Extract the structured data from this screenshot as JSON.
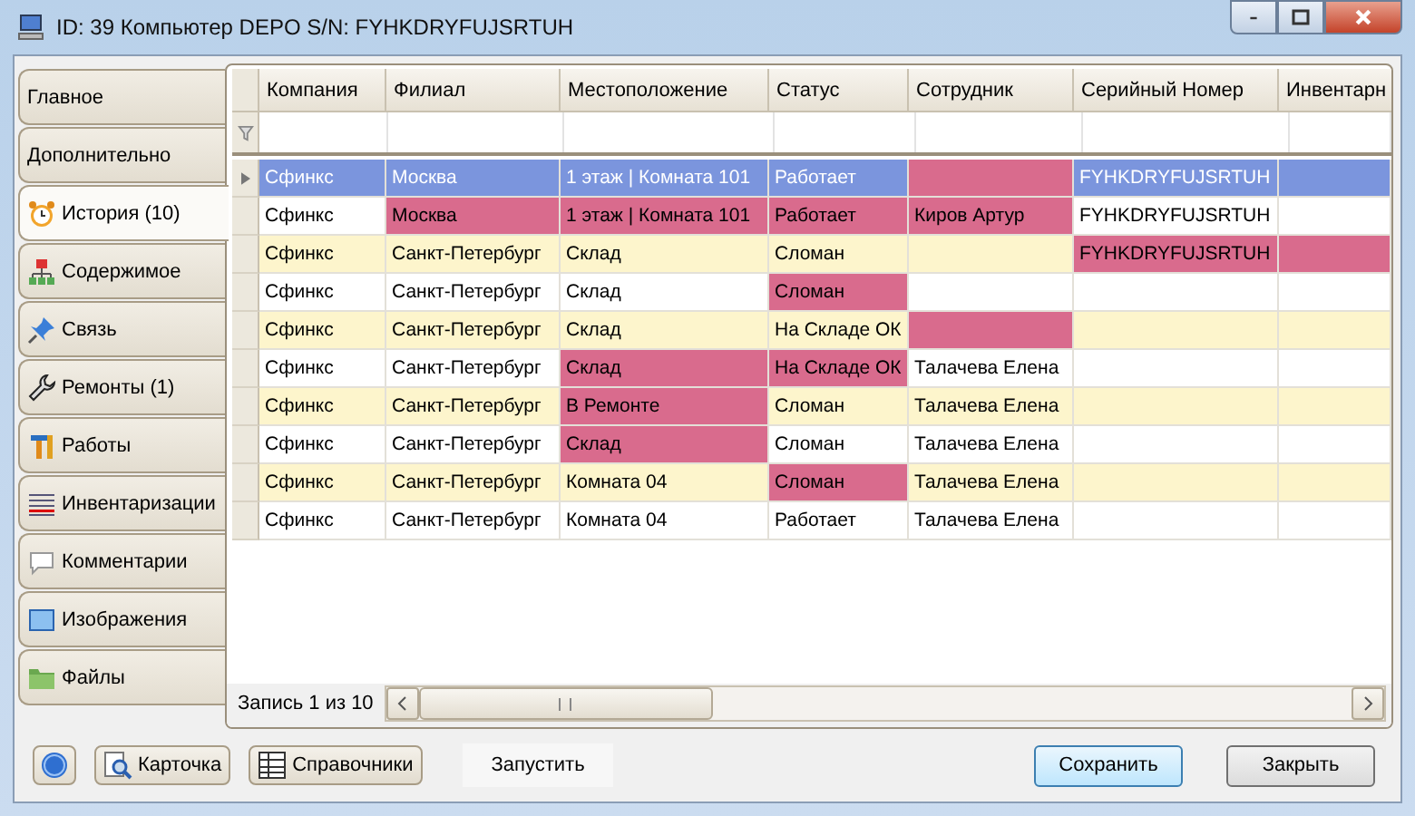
{
  "window": {
    "title": "ID: 39  Компьютер DEPO S/N: FYHKDRYFUJSRTUH"
  },
  "tabs": [
    {
      "label": "Главное",
      "selected": false
    },
    {
      "label": "Дополнительно",
      "selected": false
    },
    {
      "label": "История (10)",
      "selected": true
    },
    {
      "label": "Содержимое",
      "selected": false
    },
    {
      "label": "Связь",
      "selected": false
    },
    {
      "label": "Ремонты (1)",
      "selected": false
    },
    {
      "label": "Работы",
      "selected": false
    },
    {
      "label": "Инвентаризации",
      "selected": false
    },
    {
      "label": "Комментарии",
      "selected": false
    },
    {
      "label": "Изображения",
      "selected": false
    },
    {
      "label": "Файлы",
      "selected": false
    }
  ],
  "table": {
    "columns": [
      "Компания",
      "Филиал",
      "Местоположение",
      "Статус",
      "Сотрудник",
      "Серийный Номер",
      "Инвентарн"
    ],
    "rows": [
      {
        "selected": true,
        "cells": [
          {
            "text": "Сфинкс",
            "highlighted": false
          },
          {
            "text": "Москва",
            "highlighted": false
          },
          {
            "text": "1 этаж | Комната 101",
            "highlighted": false
          },
          {
            "text": "Работает",
            "highlighted": false
          },
          {
            "text": "",
            "highlighted": true
          },
          {
            "text": "FYHKDRYFUJSRTUH",
            "highlighted": false
          },
          {
            "text": "",
            "highlighted": false
          }
        ]
      },
      {
        "selected": false,
        "cells": [
          {
            "text": "Сфинкс",
            "highlighted": false
          },
          {
            "text": "Москва",
            "highlighted": true
          },
          {
            "text": "1 этаж | Комната 101",
            "highlighted": true
          },
          {
            "text": "Работает",
            "highlighted": true
          },
          {
            "text": "Киров Артур",
            "highlighted": true
          },
          {
            "text": "FYHKDRYFUJSRTUH",
            "highlighted": false
          },
          {
            "text": "",
            "highlighted": false
          }
        ]
      },
      {
        "selected": false,
        "cells": [
          {
            "text": "Сфинкс",
            "highlighted": false
          },
          {
            "text": "Санкт-Петербург",
            "highlighted": false
          },
          {
            "text": "Склад",
            "highlighted": false
          },
          {
            "text": "Сломан",
            "highlighted": false
          },
          {
            "text": "",
            "highlighted": false
          },
          {
            "text": "FYHKDRYFUJSRTUH",
            "highlighted": true
          },
          {
            "text": "",
            "highlighted": true
          }
        ]
      },
      {
        "selected": false,
        "cells": [
          {
            "text": "Сфинкс",
            "highlighted": false
          },
          {
            "text": "Санкт-Петербург",
            "highlighted": false
          },
          {
            "text": "Склад",
            "highlighted": false
          },
          {
            "text": "Сломан",
            "highlighted": true
          },
          {
            "text": "",
            "highlighted": false
          },
          {
            "text": "",
            "highlighted": false
          },
          {
            "text": "",
            "highlighted": false
          }
        ]
      },
      {
        "selected": false,
        "cells": [
          {
            "text": "Сфинкс",
            "highlighted": false
          },
          {
            "text": "Санкт-Петербург",
            "highlighted": false
          },
          {
            "text": "Склад",
            "highlighted": false
          },
          {
            "text": "На Складе ОК",
            "highlighted": false
          },
          {
            "text": "",
            "highlighted": true
          },
          {
            "text": "",
            "highlighted": false
          },
          {
            "text": "",
            "highlighted": false
          }
        ]
      },
      {
        "selected": false,
        "cells": [
          {
            "text": "Сфинкс",
            "highlighted": false
          },
          {
            "text": "Санкт-Петербург",
            "highlighted": false
          },
          {
            "text": "Склад",
            "highlighted": true
          },
          {
            "text": "На Складе ОК",
            "highlighted": true
          },
          {
            "text": "Талачева Елена",
            "highlighted": false
          },
          {
            "text": "",
            "highlighted": false
          },
          {
            "text": "",
            "highlighted": false
          }
        ]
      },
      {
        "selected": false,
        "cells": [
          {
            "text": "Сфинкс",
            "highlighted": false
          },
          {
            "text": "Санкт-Петербург",
            "highlighted": false
          },
          {
            "text": "В Ремонте",
            "highlighted": true
          },
          {
            "text": "Сломан",
            "highlighted": false
          },
          {
            "text": "Талачева Елена",
            "highlighted": false
          },
          {
            "text": "",
            "highlighted": false
          },
          {
            "text": "",
            "highlighted": false
          }
        ]
      },
      {
        "selected": false,
        "cells": [
          {
            "text": "Сфинкс",
            "highlighted": false
          },
          {
            "text": "Санкт-Петербург",
            "highlighted": false
          },
          {
            "text": "Склад",
            "highlighted": true
          },
          {
            "text": "Сломан",
            "highlighted": false
          },
          {
            "text": "Талачева Елена",
            "highlighted": false
          },
          {
            "text": "",
            "highlighted": false
          },
          {
            "text": "",
            "highlighted": false
          }
        ]
      },
      {
        "selected": false,
        "cells": [
          {
            "text": "Сфинкс",
            "highlighted": false
          },
          {
            "text": "Санкт-Петербург",
            "highlighted": false
          },
          {
            "text": "Комната 04",
            "highlighted": false
          },
          {
            "text": "Сломан",
            "highlighted": true
          },
          {
            "text": "Талачева Елена",
            "highlighted": false
          },
          {
            "text": "",
            "highlighted": false
          },
          {
            "text": "",
            "highlighted": false
          }
        ]
      },
      {
        "selected": false,
        "cells": [
          {
            "text": "Сфинкс",
            "highlighted": false
          },
          {
            "text": "Санкт-Петербург",
            "highlighted": false
          },
          {
            "text": "Комната 04",
            "highlighted": false
          },
          {
            "text": "Работает",
            "highlighted": false
          },
          {
            "text": "Талачева Елена",
            "highlighted": false
          },
          {
            "text": "",
            "highlighted": false
          },
          {
            "text": "",
            "highlighted": false
          }
        ]
      }
    ],
    "record_counter": "Запись 1 из 10"
  },
  "buttons": [
    {
      "label": "Карточка"
    },
    {
      "label": "Справочники"
    },
    {
      "label": "Запустить"
    },
    {
      "label": "Сохранить"
    },
    {
      "label": "Закрыть"
    }
  ]
}
